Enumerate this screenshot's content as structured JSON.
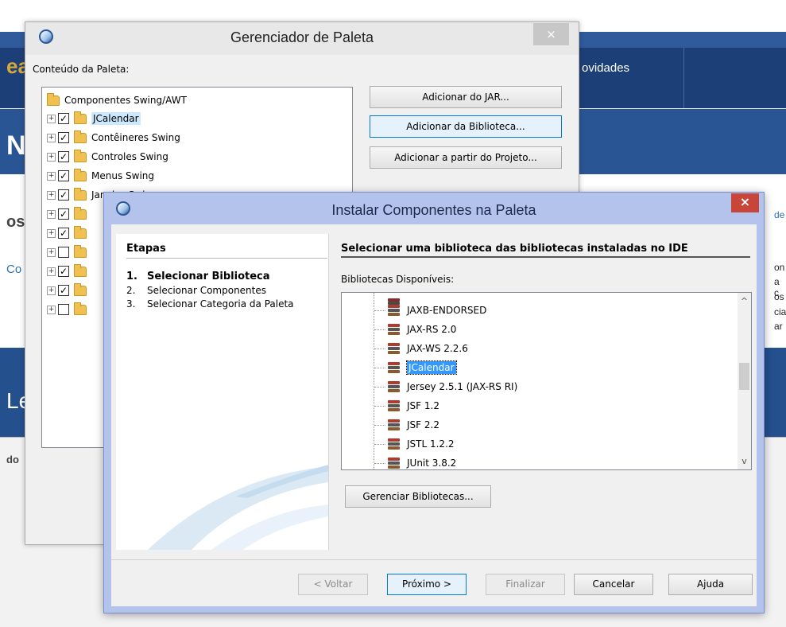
{
  "background": {
    "nav_text": "ovidades",
    "letters": [
      "ea",
      "N",
      "os",
      "Co",
      "Le",
      "do"
    ],
    "right_side": [
      "de",
      "on",
      "a c",
      "os",
      "cia",
      "ar"
    ]
  },
  "palette_manager": {
    "title": "Gerenciador de Paleta",
    "close_glyph": "×",
    "content_label": "Conteúdo da Paleta:",
    "tree": {
      "root": "Componentes Swing/AWT",
      "items": [
        {
          "label": "JCalendar",
          "checked": true
        },
        {
          "label": "Contêineres Swing",
          "checked": true
        },
        {
          "label": "Controles Swing",
          "checked": true
        },
        {
          "label": "Menus Swing",
          "checked": true
        },
        {
          "label": "Janelas Swing",
          "checked": true
        },
        {
          "label": "",
          "checked": true
        },
        {
          "label": "",
          "checked": true
        },
        {
          "label": "",
          "checked": false
        },
        {
          "label": "",
          "checked": true
        },
        {
          "label": "",
          "checked": true
        },
        {
          "label": "",
          "checked": false
        }
      ]
    },
    "buttons": {
      "add_jar": "Adicionar do JAR...",
      "add_library": "Adicionar da Biblioteca...",
      "add_project": "Adicionar a partir do Projeto..."
    }
  },
  "install_wizard": {
    "title": "Instalar Componentes na Paleta",
    "close_glyph": "×",
    "steps": {
      "heading": "Etapas",
      "items": [
        {
          "num": "1.",
          "label": "Selecionar Biblioteca"
        },
        {
          "num": "2.",
          "label": "Selecionar Componentes"
        },
        {
          "num": "3.",
          "label": "Selecionar Categoria da Paleta"
        }
      ]
    },
    "panel_title": "Selecionar uma biblioteca das bibliotecas instaladas no IDE",
    "libraries_label": "Bibliotecas Disponíveis:",
    "libraries": [
      "JAXB-ENDORSED",
      "JAX-RS 2.0",
      "JAX-WS 2.2.6",
      "JCalendar",
      "Jersey 2.5.1 (JAX-RS RI)",
      "JSF 1.2",
      "JSF 2.2",
      "JSTL 1.2.2",
      "JUnit 3.8.2"
    ],
    "selected_library": "JCalendar",
    "manage_button": "Gerenciar Bibliotecas...",
    "footer": {
      "back": "< Voltar",
      "next": "Próximo >",
      "finish": "Finalizar",
      "cancel": "Cancelar",
      "help": "Ajuda"
    },
    "scroll_up": "^",
    "scroll_down": "v"
  }
}
